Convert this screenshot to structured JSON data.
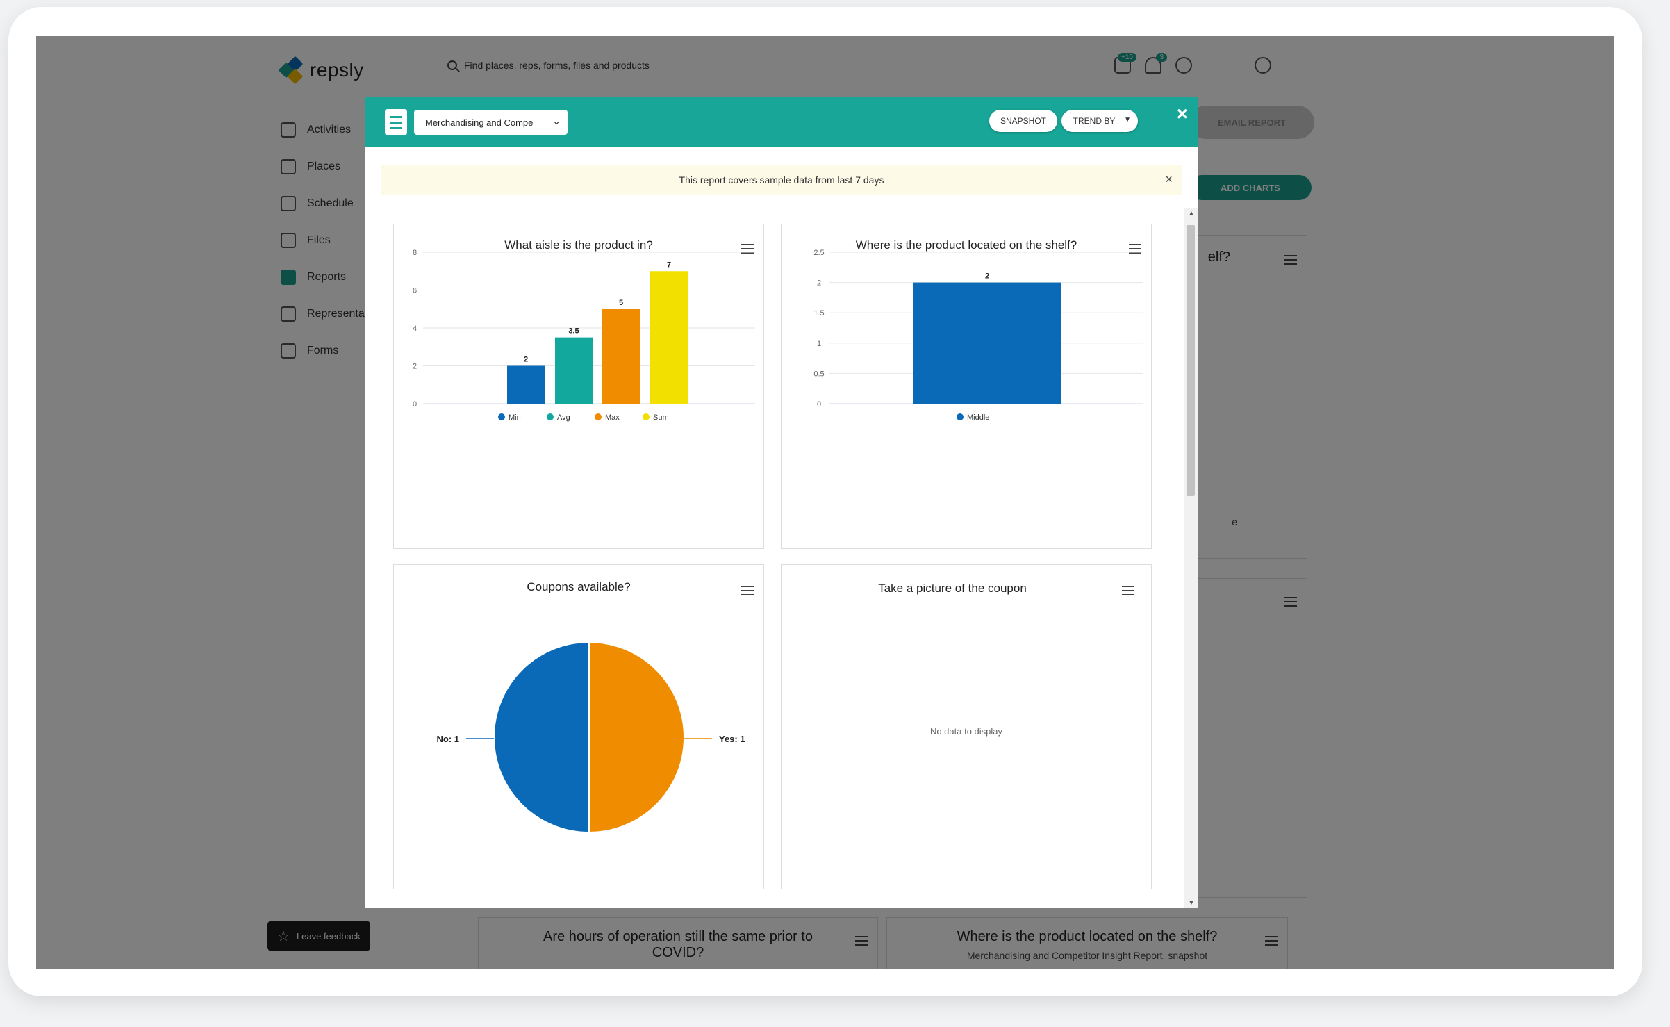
{
  "app": {
    "brand": "repsly",
    "search_placeholder": "Find places, reps, forms, files and products",
    "badges": {
      "inbox": "+10",
      "notifications": "3"
    },
    "nav": [
      {
        "label": "Activities",
        "icon": "activities-icon"
      },
      {
        "label": "Places",
        "icon": "store-icon"
      },
      {
        "label": "Schedule",
        "icon": "calendar-icon"
      },
      {
        "label": "Files",
        "icon": "folder-icon"
      },
      {
        "label": "Reports",
        "icon": "reports-icon",
        "active": true
      },
      {
        "label": "Representat",
        "icon": "person-icon"
      },
      {
        "label": "Forms",
        "icon": "forms-icon"
      }
    ],
    "feedback_label": "Leave feedback",
    "email_report_label": "EMAIL REPORT",
    "add_charts_label": "ADD CHARTS",
    "bg_cards": {
      "top_right_title_fragment": "elf?",
      "top_right_label_fragment": "e",
      "bottom_left_title": "Are hours of operation still the same prior to COVID?",
      "bottom_right_title": "Where is the product located on the shelf?",
      "bottom_right_subtitle": "Merchandising and Competitor Insight Report, snapshot"
    }
  },
  "modal": {
    "report_select": "Merchandising and Compe",
    "snapshot_label": "SNAPSHOT",
    "trend_by_label": "TREND BY",
    "close_label": "×",
    "banner_text": "This report covers sample data from last 7 days",
    "banner_close": "×",
    "cards": {
      "aisle_title": "What aisle is the product in?",
      "shelf_title": "Where is the product located on the shelf?",
      "coupons_title": "Coupons available?",
      "picture_title": "Take a picture of the coupon",
      "picture_empty": "No data to display"
    }
  },
  "colors": {
    "teal": "#17a697",
    "blue": "#0a6ab8",
    "green": "#13a89e",
    "orange": "#f08c00",
    "yellow": "#f2e000"
  },
  "chart_data": [
    {
      "type": "bar",
      "title": "What aisle is the product in?",
      "categories": [
        "Min",
        "Avg",
        "Max",
        "Sum"
      ],
      "values": [
        2,
        3.5,
        5,
        7
      ],
      "colors": [
        "#0a6ab8",
        "#13a89e",
        "#f08c00",
        "#f2e000"
      ],
      "yticks": [
        0,
        2,
        4,
        6,
        8
      ],
      "ylim": [
        0,
        8
      ],
      "legend": [
        "Min",
        "Avg",
        "Max",
        "Sum"
      ],
      "legend_position": "bottom",
      "grid": true
    },
    {
      "type": "bar",
      "title": "Where is the product located on the shelf?",
      "categories": [
        "Middle"
      ],
      "values": [
        2
      ],
      "colors": [
        "#0a6ab8"
      ],
      "yticks": [
        0,
        0.5,
        1,
        1.5,
        2,
        2.5
      ],
      "ylim": [
        0,
        2.5
      ],
      "legend": [
        "Middle"
      ],
      "legend_position": "bottom",
      "grid": true
    },
    {
      "type": "pie",
      "title": "Coupons available?",
      "slices": [
        {
          "label": "Yes",
          "value": 1,
          "display": "Yes: 1",
          "color": "#f08c00"
        },
        {
          "label": "No",
          "value": 1,
          "display": "No: 1",
          "color": "#0a6ab8"
        }
      ]
    }
  ]
}
